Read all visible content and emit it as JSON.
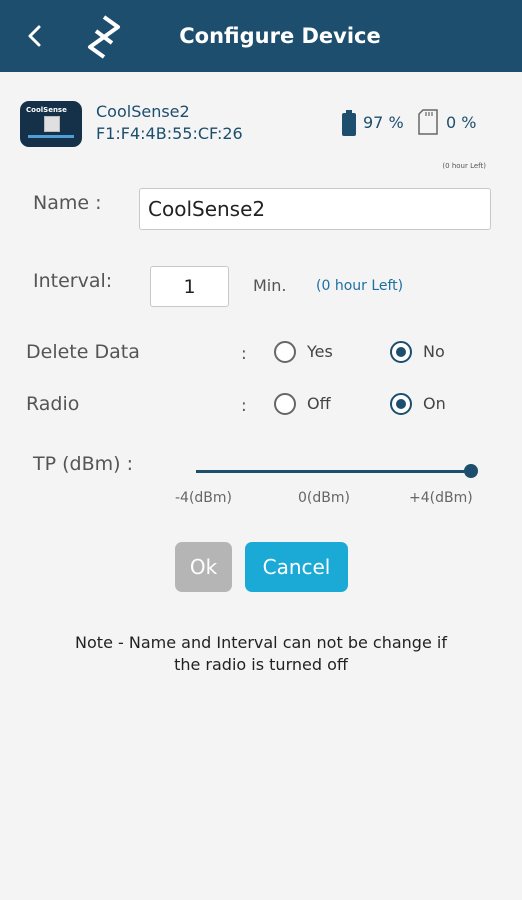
{
  "header": {
    "title": "Configure Device"
  },
  "device": {
    "thumb_label": "CoolSense",
    "name": "CoolSense2",
    "mac": "F1:F4:4B:55:CF:26",
    "battery": "97 %",
    "storage": "0 %",
    "hours_left_small": "(0 hour Left)"
  },
  "form": {
    "name_label": "Name :",
    "name_value": "CoolSense2",
    "interval_label": "Interval:",
    "interval_value": "1",
    "interval_unit": "Min.",
    "interval_left": "(0 hour Left)",
    "delete_data": {
      "label": "Delete Data",
      "colon": ":",
      "options": [
        "Yes",
        "No"
      ],
      "selected": "No"
    },
    "radio": {
      "label": "Radio",
      "colon": ":",
      "options": [
        "Off",
        "On"
      ],
      "selected": "On"
    },
    "tp": {
      "label": "TP (dBm) :",
      "ticks": [
        "-4(dBm)",
        "0(dBm)",
        "+4(dBm)"
      ],
      "value": 4
    }
  },
  "buttons": {
    "ok": "Ok",
    "cancel": "Cancel"
  },
  "note": {
    "line1": "Note - Name and Interval can not be change if",
    "line2": "the radio is turned off"
  },
  "colors": {
    "header_bg": "#1d4e6e",
    "accent": "#1baad6",
    "ok_button": "#b5b5b5"
  }
}
